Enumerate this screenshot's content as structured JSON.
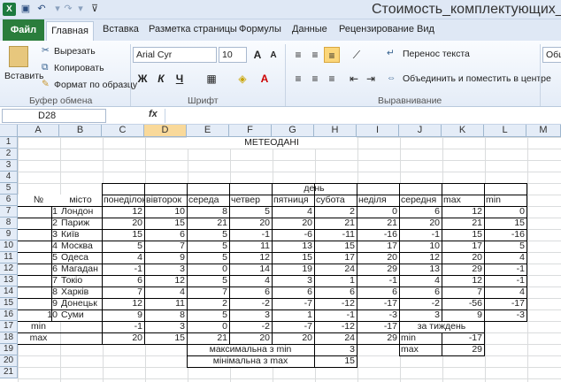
{
  "title": {
    "document": "Стоимость_комплектующих_И",
    "app_icon": "X"
  },
  "tabs": {
    "file": "Файл",
    "home": "Главная",
    "insert": "Вставка",
    "layout": "Разметка страницы",
    "formulas": "Формулы",
    "data": "Данные",
    "review": "Рецензирование",
    "view": "Вид"
  },
  "ribbon": {
    "paste": "Вставить",
    "cut": "Вырезать",
    "copy": "Копировать",
    "format_painter": "Формат по образцу",
    "clipboard": "Буфер обмена",
    "font_name": "Arial Cyr",
    "font_size": "10",
    "font_group": "Шрифт",
    "bold": "Ж",
    "italic": "К",
    "underline": "Ч",
    "wrap": "Перенос текста",
    "merge": "Объединить и поместить в центре",
    "align_group": "Выравнивание",
    "number_format": "Общ"
  },
  "formula_bar": {
    "name": "D28",
    "fx": "fx",
    "value": ""
  },
  "columns": [
    "A",
    "B",
    "C",
    "D",
    "E",
    "F",
    "G",
    "H",
    "I",
    "J",
    "K",
    "L",
    "M"
  ],
  "rows": [
    "1",
    "2",
    "3",
    "4",
    "5",
    "6",
    "7",
    "8",
    "9",
    "10",
    "11",
    "12",
    "13",
    "14",
    "15",
    "16",
    "17",
    "18",
    "19",
    "20",
    "21"
  ],
  "sheet": {
    "title": "МЕТЕОДАНІ",
    "day": "день",
    "num_header": "№",
    "city_header": "місто",
    "days": [
      "понеділок",
      "вівторок",
      "середа",
      "четвер",
      "пятниця",
      "субота",
      "неділя",
      "середня",
      "max",
      "min"
    ],
    "data": [
      {
        "n": "1",
        "city": "Лондон",
        "v": [
          "12",
          "10",
          "8",
          "5",
          "4",
          "2",
          "0",
          "6",
          "12",
          "0"
        ]
      },
      {
        "n": "2",
        "city": "Париж",
        "v": [
          "20",
          "15",
          "21",
          "20",
          "20",
          "21",
          "21",
          "20",
          "21",
          "15"
        ]
      },
      {
        "n": "3",
        "city": "Київ",
        "v": [
          "15",
          "6",
          "5",
          "-1",
          "-6",
          "-11",
          "-16",
          "-1",
          "15",
          "-16"
        ]
      },
      {
        "n": "4",
        "city": "Москва",
        "v": [
          "5",
          "7",
          "5",
          "11",
          "13",
          "15",
          "17",
          "10",
          "17",
          "5"
        ]
      },
      {
        "n": "5",
        "city": "Одеса",
        "v": [
          "4",
          "9",
          "5",
          "12",
          "15",
          "17",
          "20",
          "12",
          "20",
          "4"
        ]
      },
      {
        "n": "6",
        "city": "Магадан",
        "v": [
          "-1",
          "3",
          "0",
          "14",
          "19",
          "24",
          "29",
          "13",
          "29",
          "-1"
        ]
      },
      {
        "n": "7",
        "city": "Токіо",
        "v": [
          "6",
          "12",
          "5",
          "4",
          "3",
          "1",
          "-1",
          "4",
          "12",
          "-1"
        ]
      },
      {
        "n": "8",
        "city": "Харків",
        "v": [
          "7",
          "4",
          "7",
          "6",
          "6",
          "6",
          "6",
          "6",
          "7",
          "4"
        ]
      },
      {
        "n": "9",
        "city": "Донецьк",
        "v": [
          "12",
          "11",
          "2",
          "-2",
          "-7",
          "-12",
          "-17",
          "-2",
          "-56",
          "-17"
        ]
      },
      {
        "n": "10",
        "city": "Суми",
        "v": [
          "9",
          "8",
          "5",
          "3",
          "1",
          "-1",
          "-3",
          "3",
          "9",
          "-3"
        ]
      }
    ],
    "min_label": "min",
    "max_label": "max",
    "min_row": [
      "-1",
      "3",
      "0",
      "-2",
      "-7",
      "-12",
      "-17"
    ],
    "max_row": [
      "20",
      "15",
      "21",
      "20",
      "20",
      "24",
      "29"
    ],
    "week_label": "за тиждень",
    "week_min_label": "min",
    "week_min": "-17",
    "week_max_label": "max",
    "week_max": "29",
    "max_of_min_label": "максимальна з min",
    "max_of_min": "3",
    "min_of_max_label": "мінімальна з max",
    "min_of_max": "15"
  }
}
